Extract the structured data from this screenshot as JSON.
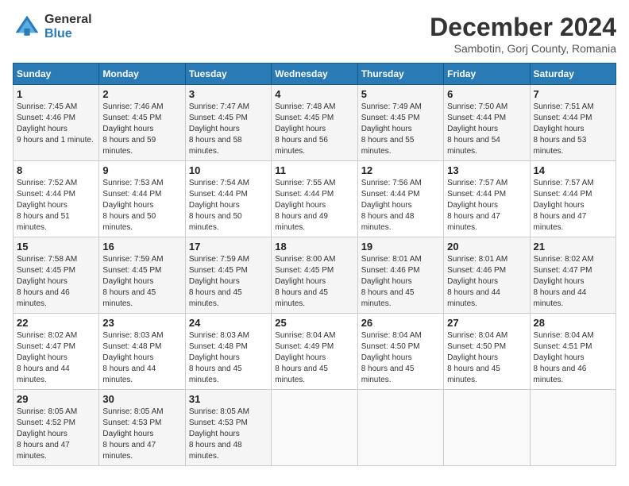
{
  "header": {
    "logo": {
      "line1": "General",
      "line2": "Blue"
    },
    "title": "December 2024",
    "subtitle": "Sambotin, Gorj County, Romania"
  },
  "weekdays": [
    "Sunday",
    "Monday",
    "Tuesday",
    "Wednesday",
    "Thursday",
    "Friday",
    "Saturday"
  ],
  "weeks": [
    [
      {
        "day": "1",
        "sunrise": "7:45 AM",
        "sunset": "4:46 PM",
        "daylight": "9 hours and 1 minute."
      },
      {
        "day": "2",
        "sunrise": "7:46 AM",
        "sunset": "4:45 PM",
        "daylight": "8 hours and 59 minutes."
      },
      {
        "day": "3",
        "sunrise": "7:47 AM",
        "sunset": "4:45 PM",
        "daylight": "8 hours and 58 minutes."
      },
      {
        "day": "4",
        "sunrise": "7:48 AM",
        "sunset": "4:45 PM",
        "daylight": "8 hours and 56 minutes."
      },
      {
        "day": "5",
        "sunrise": "7:49 AM",
        "sunset": "4:45 PM",
        "daylight": "8 hours and 55 minutes."
      },
      {
        "day": "6",
        "sunrise": "7:50 AM",
        "sunset": "4:44 PM",
        "daylight": "8 hours and 54 minutes."
      },
      {
        "day": "7",
        "sunrise": "7:51 AM",
        "sunset": "4:44 PM",
        "daylight": "8 hours and 53 minutes."
      }
    ],
    [
      {
        "day": "8",
        "sunrise": "7:52 AM",
        "sunset": "4:44 PM",
        "daylight": "8 hours and 51 minutes."
      },
      {
        "day": "9",
        "sunrise": "7:53 AM",
        "sunset": "4:44 PM",
        "daylight": "8 hours and 50 minutes."
      },
      {
        "day": "10",
        "sunrise": "7:54 AM",
        "sunset": "4:44 PM",
        "daylight": "8 hours and 50 minutes."
      },
      {
        "day": "11",
        "sunrise": "7:55 AM",
        "sunset": "4:44 PM",
        "daylight": "8 hours and 49 minutes."
      },
      {
        "day": "12",
        "sunrise": "7:56 AM",
        "sunset": "4:44 PM",
        "daylight": "8 hours and 48 minutes."
      },
      {
        "day": "13",
        "sunrise": "7:57 AM",
        "sunset": "4:44 PM",
        "daylight": "8 hours and 47 minutes."
      },
      {
        "day": "14",
        "sunrise": "7:57 AM",
        "sunset": "4:44 PM",
        "daylight": "8 hours and 47 minutes."
      }
    ],
    [
      {
        "day": "15",
        "sunrise": "7:58 AM",
        "sunset": "4:45 PM",
        "daylight": "8 hours and 46 minutes."
      },
      {
        "day": "16",
        "sunrise": "7:59 AM",
        "sunset": "4:45 PM",
        "daylight": "8 hours and 45 minutes."
      },
      {
        "day": "17",
        "sunrise": "7:59 AM",
        "sunset": "4:45 PM",
        "daylight": "8 hours and 45 minutes."
      },
      {
        "day": "18",
        "sunrise": "8:00 AM",
        "sunset": "4:45 PM",
        "daylight": "8 hours and 45 minutes."
      },
      {
        "day": "19",
        "sunrise": "8:01 AM",
        "sunset": "4:46 PM",
        "daylight": "8 hours and 45 minutes."
      },
      {
        "day": "20",
        "sunrise": "8:01 AM",
        "sunset": "4:46 PM",
        "daylight": "8 hours and 44 minutes."
      },
      {
        "day": "21",
        "sunrise": "8:02 AM",
        "sunset": "4:47 PM",
        "daylight": "8 hours and 44 minutes."
      }
    ],
    [
      {
        "day": "22",
        "sunrise": "8:02 AM",
        "sunset": "4:47 PM",
        "daylight": "8 hours and 44 minutes."
      },
      {
        "day": "23",
        "sunrise": "8:03 AM",
        "sunset": "4:48 PM",
        "daylight": "8 hours and 44 minutes."
      },
      {
        "day": "24",
        "sunrise": "8:03 AM",
        "sunset": "4:48 PM",
        "daylight": "8 hours and 45 minutes."
      },
      {
        "day": "25",
        "sunrise": "8:04 AM",
        "sunset": "4:49 PM",
        "daylight": "8 hours and 45 minutes."
      },
      {
        "day": "26",
        "sunrise": "8:04 AM",
        "sunset": "4:50 PM",
        "daylight": "8 hours and 45 minutes."
      },
      {
        "day": "27",
        "sunrise": "8:04 AM",
        "sunset": "4:50 PM",
        "daylight": "8 hours and 45 minutes."
      },
      {
        "day": "28",
        "sunrise": "8:04 AM",
        "sunset": "4:51 PM",
        "daylight": "8 hours and 46 minutes."
      }
    ],
    [
      {
        "day": "29",
        "sunrise": "8:05 AM",
        "sunset": "4:52 PM",
        "daylight": "8 hours and 47 minutes."
      },
      {
        "day": "30",
        "sunrise": "8:05 AM",
        "sunset": "4:53 PM",
        "daylight": "8 hours and 47 minutes."
      },
      {
        "day": "31",
        "sunrise": "8:05 AM",
        "sunset": "4:53 PM",
        "daylight": "8 hours and 48 minutes."
      },
      null,
      null,
      null,
      null
    ]
  ],
  "labels": {
    "sunrise_prefix": "Sunrise: ",
    "sunset_prefix": "Sunset: ",
    "daylight_label": "Daylight hours"
  }
}
